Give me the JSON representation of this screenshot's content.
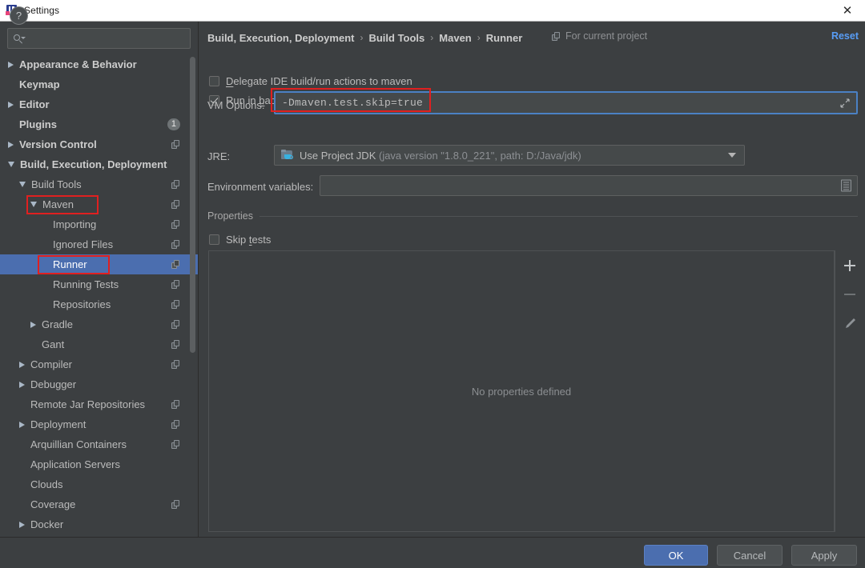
{
  "window": {
    "title": "Settings",
    "close_label": "✕",
    "app_icon": "intellij-idea-icon"
  },
  "sidebar": {
    "search": {
      "placeholder": "",
      "value": "",
      "icon": "search-icon"
    },
    "items": [
      {
        "label": "Appearance & Behavior",
        "indent": 0,
        "arrow": "right",
        "bold": true,
        "scope": false,
        "badge": null,
        "selected": false,
        "annotated": false
      },
      {
        "label": "Keymap",
        "indent": 0,
        "arrow": "none",
        "bold": true,
        "scope": false,
        "badge": null,
        "selected": false,
        "annotated": false
      },
      {
        "label": "Editor",
        "indent": 0,
        "arrow": "right",
        "bold": true,
        "scope": false,
        "badge": null,
        "selected": false,
        "annotated": false
      },
      {
        "label": "Plugins",
        "indent": 0,
        "arrow": "none",
        "bold": true,
        "scope": false,
        "badge": "1",
        "selected": false,
        "annotated": false
      },
      {
        "label": "Version Control",
        "indent": 0,
        "arrow": "right",
        "bold": true,
        "scope": true,
        "badge": null,
        "selected": false,
        "annotated": false
      },
      {
        "label": "Build, Execution, Deployment",
        "indent": 0,
        "arrow": "down",
        "bold": true,
        "scope": false,
        "badge": null,
        "selected": false,
        "annotated": false
      },
      {
        "label": "Build Tools",
        "indent": 1,
        "arrow": "down",
        "bold": false,
        "scope": true,
        "badge": null,
        "selected": false,
        "annotated": false
      },
      {
        "label": "Maven",
        "indent": 2,
        "arrow": "down",
        "bold": false,
        "scope": true,
        "badge": null,
        "selected": false,
        "annotated": true
      },
      {
        "label": "Importing",
        "indent": 3,
        "arrow": "none",
        "bold": false,
        "scope": true,
        "badge": null,
        "selected": false,
        "annotated": false
      },
      {
        "label": "Ignored Files",
        "indent": 3,
        "arrow": "none",
        "bold": false,
        "scope": true,
        "badge": null,
        "selected": false,
        "annotated": false
      },
      {
        "label": "Runner",
        "indent": 3,
        "arrow": "none",
        "bold": false,
        "scope": true,
        "badge": null,
        "selected": true,
        "annotated": true
      },
      {
        "label": "Running Tests",
        "indent": 3,
        "arrow": "none",
        "bold": false,
        "scope": true,
        "badge": null,
        "selected": false,
        "annotated": false
      },
      {
        "label": "Repositories",
        "indent": 3,
        "arrow": "none",
        "bold": false,
        "scope": true,
        "badge": null,
        "selected": false,
        "annotated": false
      },
      {
        "label": "Gradle",
        "indent": 2,
        "arrow": "right",
        "bold": false,
        "scope": true,
        "badge": null,
        "selected": false,
        "annotated": false
      },
      {
        "label": "Gant",
        "indent": 2,
        "arrow": "none",
        "bold": false,
        "scope": true,
        "badge": null,
        "selected": false,
        "annotated": false
      },
      {
        "label": "Compiler",
        "indent": 1,
        "arrow": "right",
        "bold": false,
        "scope": true,
        "badge": null,
        "selected": false,
        "annotated": false
      },
      {
        "label": "Debugger",
        "indent": 1,
        "arrow": "right",
        "bold": false,
        "scope": false,
        "badge": null,
        "selected": false,
        "annotated": false
      },
      {
        "label": "Remote Jar Repositories",
        "indent": 1,
        "arrow": "none",
        "bold": false,
        "scope": true,
        "badge": null,
        "selected": false,
        "annotated": false
      },
      {
        "label": "Deployment",
        "indent": 1,
        "arrow": "right",
        "bold": false,
        "scope": true,
        "badge": null,
        "selected": false,
        "annotated": false
      },
      {
        "label": "Arquillian Containers",
        "indent": 1,
        "arrow": "none",
        "bold": false,
        "scope": true,
        "badge": null,
        "selected": false,
        "annotated": false
      },
      {
        "label": "Application Servers",
        "indent": 1,
        "arrow": "none",
        "bold": false,
        "scope": false,
        "badge": null,
        "selected": false,
        "annotated": false
      },
      {
        "label": "Clouds",
        "indent": 1,
        "arrow": "none",
        "bold": false,
        "scope": false,
        "badge": null,
        "selected": false,
        "annotated": false
      },
      {
        "label": "Coverage",
        "indent": 1,
        "arrow": "none",
        "bold": false,
        "scope": true,
        "badge": null,
        "selected": false,
        "annotated": false
      },
      {
        "label": "Docker",
        "indent": 1,
        "arrow": "right",
        "bold": false,
        "scope": false,
        "badge": null,
        "selected": false,
        "annotated": false
      }
    ]
  },
  "main": {
    "breadcrumb": [
      "Build, Execution, Deployment",
      "Build Tools",
      "Maven",
      "Runner"
    ],
    "breadcrumb_separator": "›",
    "scope_note": "For current project",
    "scope_note_icon": "project-scope-icon",
    "reset_label": "Reset",
    "checkbox_delegate": {
      "label_before": "D",
      "label_after": "elegate IDE build/run actions to maven",
      "checked": false
    },
    "checkbox_run_bg": {
      "label_before": "Run in ",
      "mnemonic": "b",
      "label_after": "ackground",
      "checked": true
    },
    "vm_options": {
      "label": "VM Options:",
      "value": "-Dmaven.test.skip=true",
      "expand_icon": "expand-arrows-icon"
    },
    "jre": {
      "label": "JRE:",
      "value_main": "Use Project JDK",
      "value_detail": " (java version \"1.8.0_221\", path: D:/Java/jdk)",
      "icon": "jdk-folder-icon",
      "arrow_icon": "chevron-down-icon"
    },
    "env_vars": {
      "label": "Environment variables:",
      "value": "",
      "browse_icon": "browse-list-icon"
    },
    "properties_group": {
      "title": "Properties",
      "skip_tests": {
        "label_before": "Skip ",
        "mnemonic": "t",
        "label_after": "ests",
        "checked": false
      },
      "empty_text": "No properties defined",
      "toolbar": [
        {
          "name": "add-property-button",
          "icon": "plus-icon",
          "enabled": true
        },
        {
          "name": "remove-property-button",
          "icon": "minus-icon",
          "enabled": false
        },
        {
          "name": "edit-property-button",
          "icon": "pencil-icon",
          "enabled": true
        }
      ]
    }
  },
  "footer": {
    "help_label": "?",
    "ok_label": "OK",
    "cancel_label": "Cancel",
    "apply_label": "Apply"
  },
  "colors": {
    "accent_blue": "#4b6eaf",
    "link_blue": "#589df6",
    "annotation_red": "#e02020",
    "panel_bg": "#3c3f41",
    "field_bg": "#45494a"
  }
}
